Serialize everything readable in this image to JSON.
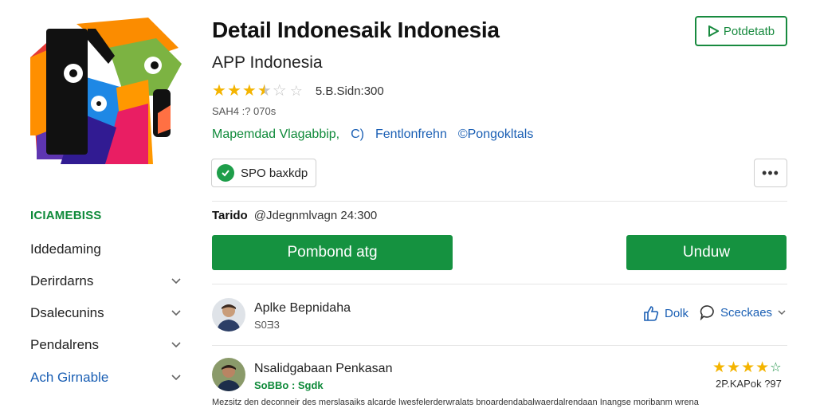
{
  "app": {
    "title": "Detail Indonesaik Indonesia",
    "subtitle": "APP Indonesia",
    "rating_stars": 3.5,
    "rating_text": "5.B.Sidn:300",
    "size_text": "SAH4 :? 070s",
    "tags": [
      "Mapemdad Vlagabbip,",
      "C)",
      "Fentlonfrehn",
      "©Pongokltals"
    ],
    "badge_label": "SPO baxkdp",
    "top_button_label": "Potdetatb",
    "more_label": "•••"
  },
  "meta": {
    "label": "Tarido",
    "value": "@Jdegnmlvagn 24:300"
  },
  "buttons": {
    "primary_left": "Pombond atg",
    "primary_right": "Unduw"
  },
  "sidebar": {
    "title": "ICIAMEBISS",
    "items": [
      {
        "label": "Iddedaming",
        "expandable": false
      },
      {
        "label": "Derirdarns",
        "expandable": true
      },
      {
        "label": "Dsalecunins",
        "expandable": true
      },
      {
        "label": "Pendalrens",
        "expandable": true
      },
      {
        "label": "Ach Girnable",
        "expandable": true
      }
    ]
  },
  "reviews": [
    {
      "name": "Aplke Bepnidaha",
      "sub": "S0Ǝ3",
      "like_label": "Dolk",
      "share_label": "Sceckaes"
    },
    {
      "name": "Nsalidgabaan Penkasan",
      "sub": "SoBBo : Sgdk",
      "stars": 4,
      "score": "2P.KAPok ?97",
      "body": "Mezsitz den deconneir des merslasaiks alcarde lwesfelerderwralats bnoardendabalwaerdalrendaan Inangse moribanm wrena"
    }
  ],
  "colors": {
    "brand_green": "#159240",
    "link_blue": "#1a5fb4",
    "star_gold": "#f4b400"
  }
}
